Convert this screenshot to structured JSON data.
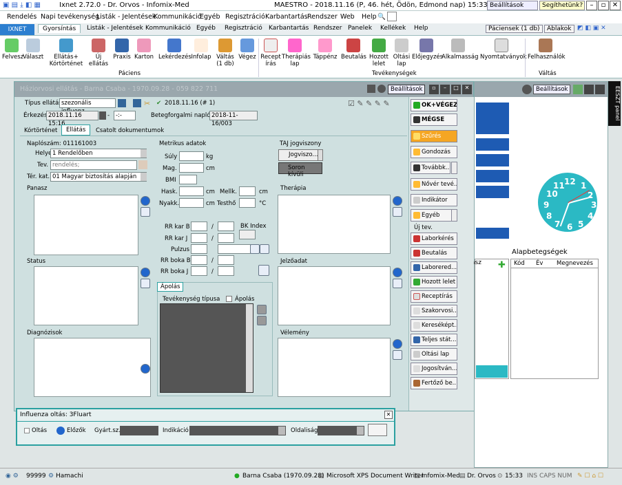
{
  "titlebar": {
    "app_title": "Ixnet 2.72.0 - Dr. Orvos - Infomix-Med",
    "center_text": "MAESTRO - 2018.11.16 (P, 46. hét, Ödön, Edmond nap) 15:33",
    "settings_label": "Beállítások",
    "help_label": "Segíthetünk?"
  },
  "menubar": [
    "Rendelés",
    "Napi tevékenység",
    "Listák - Jelentések",
    "Kommunikáció",
    "Egyéb",
    "Regisztráció",
    "Karbantartás",
    "Rendszer",
    "Web",
    "Help"
  ],
  "ribbon_tabs": {
    "app_tab": "IXNET",
    "tabs": [
      "Gyorsíntás",
      "Listák - Jelentések",
      "Kommunikáció",
      "Egyéb",
      "Regisztráció",
      "Karbantartás",
      "Rendszer",
      "Panelek",
      "Kellékek",
      "Help"
    ],
    "patients_label": "Páciensek (1 db)",
    "windows_label": "Ablakok"
  },
  "ribbon": {
    "buttons": [
      {
        "label": "Felvesz"
      },
      {
        "label": "Választ"
      },
      {
        "label": "Ellátás+\nKórtörténet"
      },
      {
        "label": "Új ellátás"
      },
      {
        "label": "Praxis"
      },
      {
        "label": "Karton"
      },
      {
        "label": "Lekérdezés"
      },
      {
        "label": "Infolap"
      },
      {
        "label": "Váltás\n(1 db)"
      },
      {
        "label": "Végez"
      },
      {
        "label": "Recept\nírás"
      },
      {
        "label": "Therápiás\nlap"
      },
      {
        "label": "Táppénz"
      },
      {
        "label": "Beutalás"
      },
      {
        "label": "Hozott\nlelet"
      },
      {
        "label": "Oltási\nlap"
      },
      {
        "label": "Előjegyzés"
      },
      {
        "label": "Alkalmasság"
      },
      {
        "label": "Nyomtatványok"
      },
      {
        "label": "Felhasználók"
      }
    ],
    "groups": [
      "Páciens",
      "Tevékenységek",
      "Váltás"
    ]
  },
  "dialog": {
    "title": "Háziorvosi ellátás - Barna Csaba - 1970.09.28 - 059 822 711",
    "settings_label": "Beállítások",
    "type_label": "Típus ellátás:",
    "type_value": "szezonális influenz",
    "date_badge": "2018.11.16 (# 1)",
    "arrival_label": "Érkezés",
    "arrival_value": "2018.11.16 15:16",
    "arrival_dash": "-:-",
    "log_label": "Betegforgalmi napló",
    "log_value": "2018-11-16/003",
    "tabs": [
      "Kórtörténet",
      "Ellátás",
      "Csatolt dokumentumok"
    ],
    "journal_label": "Naplószám: 011161003",
    "place_label": "Helye",
    "place_value": "1 Rendelőben",
    "tev_label": "Tev.",
    "tev_placeholder": "rendelés;",
    "ter_label": "Tér. kat.",
    "ter_value": "01 Magyar biztosítás alapján",
    "metrics_header": "Metrikus adatok",
    "weight_label": "Súly",
    "weight_unit": "kg",
    "height_label": "Mag.",
    "height_unit": "cm",
    "bmi_label": "BMI",
    "hask_label": "Hask.",
    "hask_unit": "cm",
    "mellk_label": "Mellk.",
    "mellk_unit": "cm",
    "nyakk_label": "Nyakk.",
    "nyakk_unit": "cm",
    "testho_label": "Testhő",
    "testho_unit": "°C",
    "taj_header": "TAJ jogviszony",
    "taj_button": "Jogviszo...",
    "taj_status": "Soron kívüli",
    "panasz_label": "Panasz",
    "status_label": "Status",
    "diag_label": "Diagnózisok",
    "therapy_label": "Therápia",
    "jelzo_label": "Jelzőadat",
    "velemeny_label": "Vélemény",
    "rr_kar_b": "RR kar B",
    "rr_kar_j": "RR kar J",
    "pulzus": "Pulzus",
    "rr_boka_b": "RR boka B",
    "rr_boka_j": "RR boka J",
    "bk_index": "BK Index",
    "slash": "/",
    "apolas_tab": "Ápolás",
    "tev_tipus": "Tevékenység típusa",
    "apolas_check": "Ápolás"
  },
  "side_buttons": {
    "ok": "OK+VÉGEZ",
    "cancel": "MÉGSE",
    "szures": "Szűrés",
    "gondozas": "Gondozás",
    "tovabb": "Továbbk...",
    "nover": "Nővér tevé...",
    "indikator": "Indikátor",
    "egyeb": "Egyéb",
    "uj_tev": "Új tev.",
    "list": [
      "Laborkérés",
      "Beutalás",
      "Laborered...",
      "Hozott lelet",
      "Receptírás",
      "Szakorvosi...",
      "Kereséképt...",
      "Teljes stát...",
      "Oltási lap",
      "Jogosítván...",
      "Fertőző be..."
    ]
  },
  "influenza": {
    "title": "Influenza oltás: 3Fluart",
    "oltas": "Oltás",
    "elozok": "Előzők",
    "gyartsz": "Gyárt.sz.",
    "indikacio": "Indikáció",
    "oldalisag": "Oldaliság"
  },
  "right_panel": {
    "settings_label": "Beállítások",
    "eeszt": "EESZT panel",
    "alap_title": "Alapbetegségek",
    "cols": [
      "Kód",
      "Év",
      "Megnevezés"
    ],
    "asz": "asz",
    "clock_numbers": [
      "12",
      "1",
      "2",
      "3",
      "4",
      "5",
      "6",
      "7",
      "8",
      "9",
      "10",
      "11"
    ]
  },
  "statusbar": {
    "count": "99999",
    "place": "Hamachi",
    "patient": "Barna Csaba (1970.09.28)",
    "printer": "Microsoft XPS Document Writer",
    "company": "Infomix-Med",
    "doctor": "Dr. Orvos",
    "time": "15:33",
    "keys": "INS  CAPS  NUM"
  }
}
